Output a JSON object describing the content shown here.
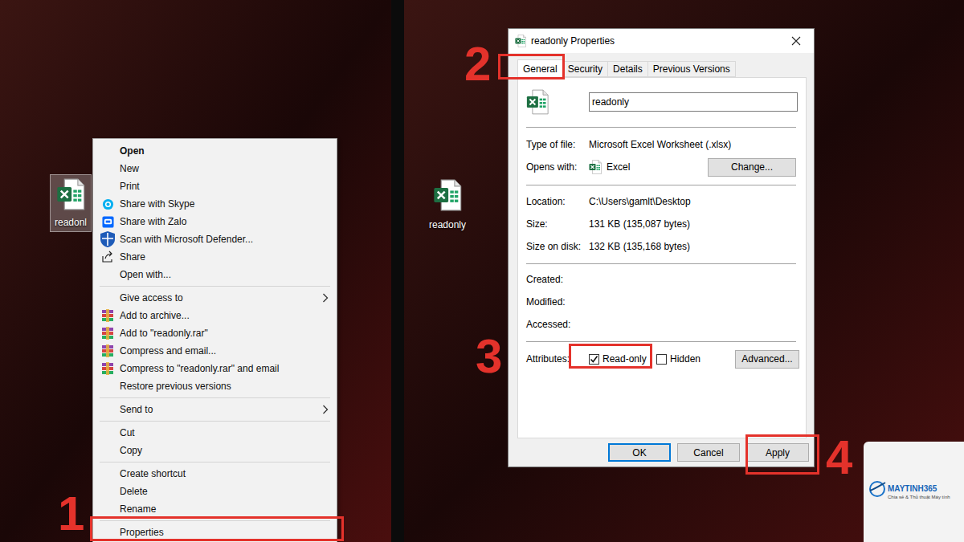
{
  "left_panel": {
    "desktop_icon": {
      "label": "readonl",
      "selected": true
    },
    "context_menu": {
      "groups": [
        [
          {
            "label": "Open",
            "kind": "plain",
            "bold": true,
            "submenu": false
          },
          {
            "label": "New",
            "kind": "plain",
            "bold": false,
            "submenu": false
          },
          {
            "label": "Print",
            "kind": "plain",
            "bold": false,
            "submenu": false
          },
          {
            "label": "Share with Skype",
            "kind": "skype",
            "bold": false,
            "submenu": false
          },
          {
            "label": "Share with Zalo",
            "kind": "zalo",
            "bold": false,
            "submenu": false
          },
          {
            "label": "Scan with Microsoft Defender...",
            "kind": "defender",
            "bold": false,
            "submenu": false
          },
          {
            "label": "Share",
            "kind": "share",
            "bold": false,
            "submenu": false
          },
          {
            "label": "Open with...",
            "kind": "plain",
            "bold": false,
            "submenu": false
          }
        ],
        [
          {
            "label": "Give access to",
            "kind": "plain",
            "bold": false,
            "submenu": true
          },
          {
            "label": "Add to archive...",
            "kind": "winrar",
            "bold": false,
            "submenu": false
          },
          {
            "label": "Add to \"readonly.rar\"",
            "kind": "winrar",
            "bold": false,
            "submenu": false
          },
          {
            "label": "Compress and email...",
            "kind": "winrar",
            "bold": false,
            "submenu": false
          },
          {
            "label": "Compress to \"readonly.rar\" and email",
            "kind": "winrar",
            "bold": false,
            "submenu": false
          },
          {
            "label": "Restore previous versions",
            "kind": "plain",
            "bold": false,
            "submenu": false
          }
        ],
        [
          {
            "label": "Send to",
            "kind": "plain",
            "bold": false,
            "submenu": true
          }
        ],
        [
          {
            "label": "Cut",
            "kind": "plain",
            "bold": false,
            "submenu": false
          },
          {
            "label": "Copy",
            "kind": "plain",
            "bold": false,
            "submenu": false
          }
        ],
        [
          {
            "label": "Create shortcut",
            "kind": "plain",
            "bold": false,
            "submenu": false
          },
          {
            "label": "Delete",
            "kind": "plain",
            "bold": false,
            "submenu": false
          },
          {
            "label": "Rename",
            "kind": "plain",
            "bold": false,
            "submenu": false
          }
        ],
        [
          {
            "label": "Properties",
            "kind": "plain",
            "bold": false,
            "submenu": false
          }
        ]
      ]
    }
  },
  "right_panel": {
    "desktop_icon": {
      "label": "readonly",
      "selected": false
    },
    "dialog": {
      "title": "readonly Properties",
      "tabs": [
        {
          "label": "General",
          "selected": true
        },
        {
          "label": "Security",
          "selected": false
        },
        {
          "label": "Details",
          "selected": false
        },
        {
          "label": "Previous Versions",
          "selected": false
        }
      ],
      "file_name": "readonly",
      "type_of_file": {
        "label": "Type of file:",
        "value": "Microsoft Excel Worksheet (.xlsx)"
      },
      "opens_with": {
        "label": "Opens with:",
        "value": "Excel",
        "button": "Change..."
      },
      "location": {
        "label": "Location:",
        "value": "C:\\Users\\gamlt\\Desktop"
      },
      "size": {
        "label": "Size:",
        "value": "131 KB (135,087 bytes)"
      },
      "size_on_disk": {
        "label": "Size on disk:",
        "value": "132 KB (135,168 bytes)"
      },
      "dates": [
        {
          "label": "Created:"
        },
        {
          "label": "Modified:"
        },
        {
          "label": "Accessed:"
        }
      ],
      "attributes": {
        "label": "Attributes:",
        "options": [
          {
            "label": "Read-only",
            "checked": true
          },
          {
            "label": "Hidden",
            "checked": false
          }
        ],
        "button": "Advanced..."
      },
      "buttons": [
        {
          "label": "OK",
          "default": true
        },
        {
          "label": "Cancel",
          "default": false
        },
        {
          "label": "Apply",
          "default": false
        }
      ]
    }
  },
  "annotations": [
    {
      "number": "1"
    },
    {
      "number": "2"
    },
    {
      "number": "3"
    },
    {
      "number": "4"
    }
  ],
  "logo": {
    "name": "MAYTINH365",
    "tagline": "Chia sẻ & Thủ thuật Máy tính"
  }
}
